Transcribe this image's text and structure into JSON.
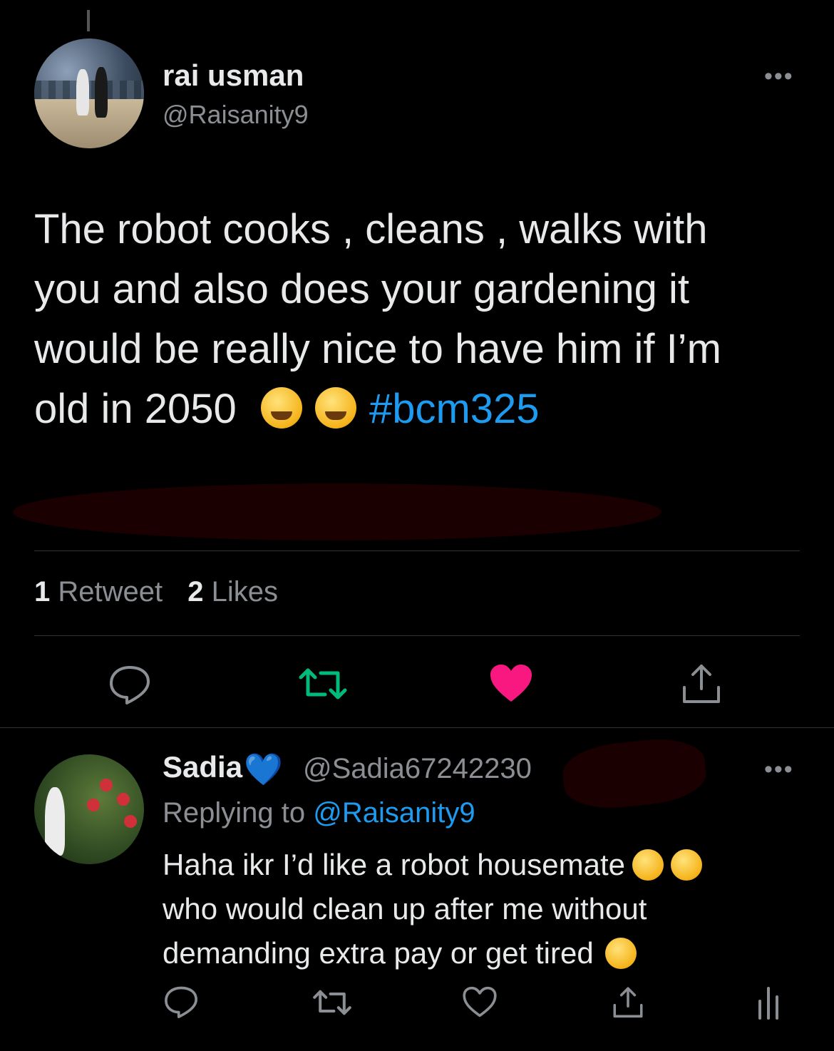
{
  "main_tweet": {
    "author_name": "rai usman",
    "author_handle": "@Raisanity9",
    "more_label": "•••",
    "text_lines": [
      "The robot cooks , cleans , walks with",
      "you and also does your gardening it",
      "would be really nice to have him if I’m"
    ],
    "last_line_text": "old in 2050",
    "hashtag": "#bcm325",
    "retweet_count": "1",
    "retweet_label": "Retweet",
    "like_count": "2",
    "like_label": "Likes",
    "liked": true,
    "colors": {
      "like_active": "#f91880",
      "retweet": "#00ba7c",
      "link": "#1d9bf0"
    },
    "actions": [
      "reply-icon",
      "retweet-icon",
      "like-icon",
      "share-icon"
    ]
  },
  "reply_tweet": {
    "author_name": "Sadia",
    "author_badge": "💙",
    "author_handle": "@Sadia67242230",
    "replying_prefix": "Replying to",
    "replying_to": "@Raisanity9",
    "more_label": "•••",
    "text_line1": "Haha ikr I’d like a robot housemate",
    "text_line2": "who would clean up after me without",
    "text_line3": "demanding extra pay or get tired",
    "actions": [
      "reply-icon",
      "retweet-icon",
      "like-icon",
      "share-icon",
      "analytics-icon"
    ]
  }
}
